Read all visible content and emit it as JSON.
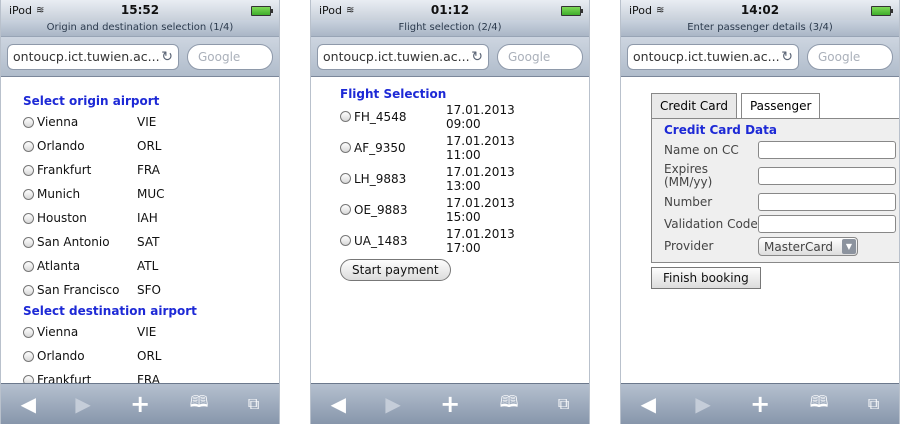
{
  "screens": [
    {
      "status": {
        "carrier": "iPod",
        "time": "15:52"
      },
      "title": "Origin and destination selection (1/4)",
      "url": "ontoucp.ict.tuwien.ac....",
      "search_placeholder": "Google",
      "origin_heading": "Select origin airport",
      "origin": [
        {
          "name": "Vienna",
          "code": "VIE"
        },
        {
          "name": "Orlando",
          "code": "ORL"
        },
        {
          "name": "Frankfurt",
          "code": "FRA"
        },
        {
          "name": "Munich",
          "code": "MUC"
        },
        {
          "name": "Houston",
          "code": "IAH"
        },
        {
          "name": "San Antonio",
          "code": "SAT"
        },
        {
          "name": "Atlanta",
          "code": "ATL"
        },
        {
          "name": "San Francisco",
          "code": "SFO"
        }
      ],
      "destination_heading": "Select destination airport",
      "destination": [
        {
          "name": "Vienna",
          "code": "VIE"
        },
        {
          "name": "Orlando",
          "code": "ORL"
        },
        {
          "name": "Frankfurt",
          "code": "FRA"
        }
      ]
    },
    {
      "status": {
        "carrier": "iPod",
        "time": "01:12"
      },
      "title": "Flight selection (2/4)",
      "url": "ontoucp.ict.tuwien.ac....",
      "search_placeholder": "Google",
      "heading": "Flight Selection",
      "flights": [
        {
          "id": "FH_4548",
          "date": "17.01.2013",
          "time": "09:00"
        },
        {
          "id": "AF_9350",
          "date": "17.01.2013",
          "time": "11:00"
        },
        {
          "id": "LH_9883",
          "date": "17.01.2013",
          "time": "13:00"
        },
        {
          "id": "OE_9883",
          "date": "17.01.2013",
          "time": "15:00"
        },
        {
          "id": "UA_1483",
          "date": "17.01.2013",
          "time": "17:00"
        }
      ],
      "button": "Start payment"
    },
    {
      "status": {
        "carrier": "iPod",
        "time": "14:02"
      },
      "title": "Enter passenger details (3/4)",
      "url": "ontoucp.ict.tuwien.ac....",
      "search_placeholder": "Google",
      "tabs": [
        "Credit Card",
        "Passenger"
      ],
      "panel_heading": "Credit Card Data",
      "fields": [
        "Name on CC",
        "Expires (MM/yy)",
        "Number",
        "Validation Code"
      ],
      "provider_label": "Provider",
      "provider_value": "MasterCard",
      "button": "Finish booking"
    }
  ],
  "toolbar": {
    "back": "◀",
    "forward": "▶",
    "add": "+",
    "bookmarks": "📖",
    "pages": "⧉"
  },
  "colors": {
    "heading": "#1d29d6",
    "toolbar": "#8796ab"
  }
}
